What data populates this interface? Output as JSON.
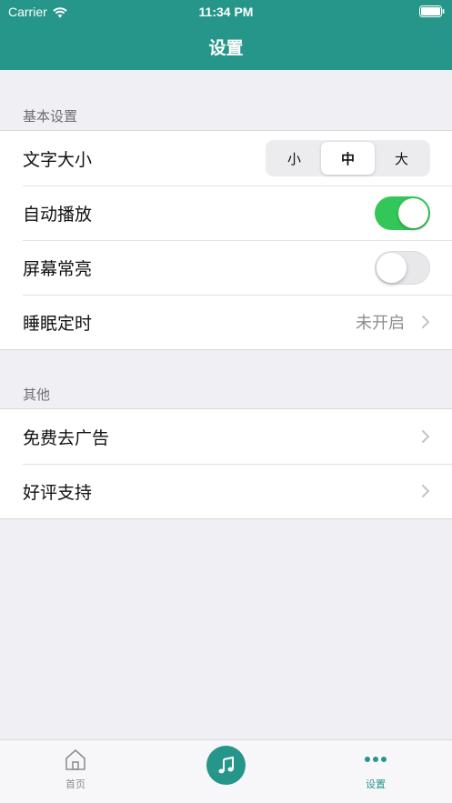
{
  "status_bar": {
    "carrier": "Carrier",
    "time": "11:34 PM"
  },
  "nav": {
    "title": "设置"
  },
  "sections": [
    {
      "header": "基本设置",
      "rows": [
        {
          "label": "文字大小",
          "type": "segmented",
          "options": [
            "小",
            "中",
            "大"
          ],
          "selected": "中"
        },
        {
          "label": "自动播放",
          "type": "toggle",
          "on": true
        },
        {
          "label": "屏幕常亮",
          "type": "toggle",
          "on": false
        },
        {
          "label": "睡眠定时",
          "type": "disclosure",
          "value": "未开启"
        }
      ]
    },
    {
      "header": "其他",
      "rows": [
        {
          "label": "免费去广告",
          "type": "disclosure"
        },
        {
          "label": "好评支持",
          "type": "disclosure"
        }
      ]
    }
  ],
  "tab_bar": {
    "tabs": [
      {
        "label": "首页",
        "icon": "home-icon"
      },
      {
        "label": "",
        "icon": "music-note-icon"
      },
      {
        "label": "设置",
        "icon": "more-dots-icon",
        "active": true
      }
    ]
  },
  "colors": {
    "brand": "#26968a",
    "toggle_on": "#33c759",
    "background": "#efeff4"
  }
}
